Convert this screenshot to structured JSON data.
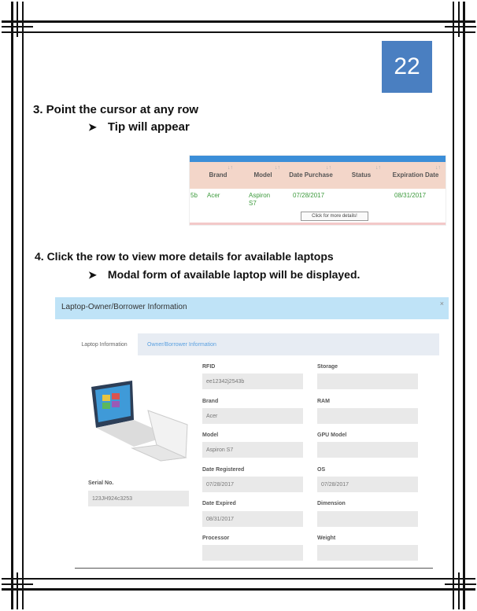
{
  "page": {
    "number": "22"
  },
  "step3": {
    "title": "3. Point the cursor at any row",
    "bullet": "Tip will appear"
  },
  "table_snippet": {
    "headers": [
      "Brand",
      "Model",
      "Date Purchase",
      "Status",
      "Expiration Date"
    ],
    "row": {
      "id_fragment": "5b",
      "brand": "Acer",
      "model": "Aspiron S7",
      "date_purchase": "07/28/2017",
      "status": "",
      "expiration_date": "08/31/2017"
    },
    "tooltip": "Click for more details!"
  },
  "step4": {
    "title": "4. Click the row to view more details for available laptops",
    "bullet": "Modal form of available laptop will be displayed."
  },
  "modal": {
    "title": "Laptop-Owner/Borrower Information",
    "close": "×",
    "tabs": [
      "Laptop Information",
      "Owner/Borrower Information"
    ],
    "serial_label": "Serial No.",
    "serial_value": "123JH924c3253",
    "fields": {
      "rfid": {
        "label": "RFID",
        "value": "ee12342j2543b"
      },
      "storage": {
        "label": "Storage",
        "value": ""
      },
      "brand": {
        "label": "Brand",
        "value": "Acer"
      },
      "ram": {
        "label": "RAM",
        "value": ""
      },
      "model": {
        "label": "Model",
        "value": "Aspiron S7"
      },
      "gpu": {
        "label": "GPU Model",
        "value": ""
      },
      "date_registered": {
        "label": "Date Registered",
        "value": "07/28/2017"
      },
      "os": {
        "label": "OS",
        "value": "07/28/2017"
      },
      "date_expired": {
        "label": "Date Expired",
        "value": "08/31/2017"
      },
      "dimension": {
        "label": "Dimension",
        "value": ""
      },
      "processor": {
        "label": "Processor",
        "value": ""
      },
      "weight": {
        "label": "Weight",
        "value": ""
      }
    }
  },
  "colors": {
    "badge": "#4a7fc1",
    "table_header": "#f3d6c9",
    "table_bar": "#3b8ed8",
    "row_text": "#3c9a3c",
    "modal_header": "#bfe3f7",
    "link": "#5aa0e0"
  }
}
